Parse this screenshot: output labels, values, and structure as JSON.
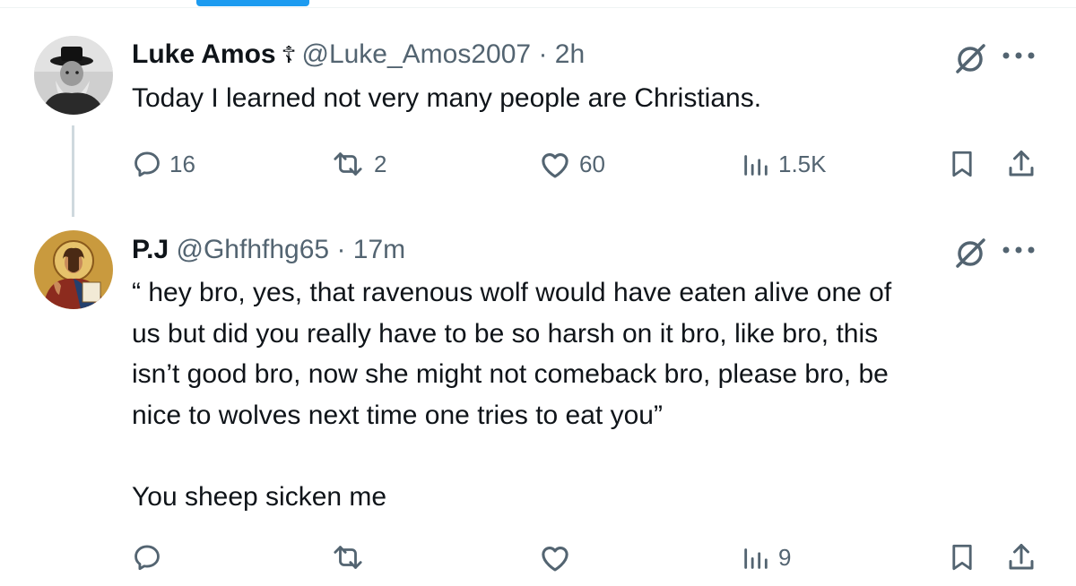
{
  "tweets": [
    {
      "name": "Luke Amos",
      "badge": "☦",
      "handle": "@Luke_Amos2007",
      "sep": "·",
      "time": "2h",
      "lines": [
        "Today I learned not very many people are Christians."
      ],
      "actions": {
        "replies": "16",
        "reposts": "2",
        "likes": "60",
        "views": "1.5K"
      }
    },
    {
      "name": "P.J",
      "handle": "@Ghfhfhg65",
      "sep": "·",
      "time": "17m",
      "lines": [
        "“ hey bro, yes,  that ravenous wolf would have eaten alive one of",
        "us but did you really have to be so harsh on it bro, like bro, this",
        "isn’t good bro, now she might not comeback bro, please bro, be",
        "nice to wolves next time one tries to eat you”",
        "",
        "You sheep sicken me"
      ],
      "actions": {
        "replies": "",
        "reposts": "",
        "likes": "",
        "views": "9"
      }
    }
  ],
  "colors": {
    "accent": "#1d9bf0",
    "text": "#0f1419",
    "muted": "#536471",
    "thread_line": "#cfd9de"
  },
  "icons": [
    "reply-icon",
    "repost-icon",
    "like-icon",
    "views-icon",
    "bookmark-icon",
    "share-icon",
    "grok-icon",
    "more-icon"
  ]
}
